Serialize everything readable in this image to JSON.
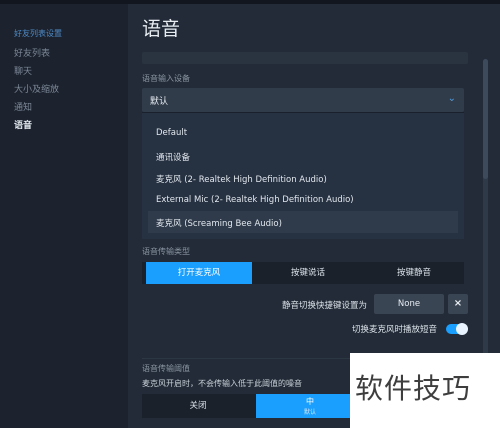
{
  "sidebar": {
    "header": "好友列表设置",
    "items": [
      {
        "label": "好友列表",
        "active": false
      },
      {
        "label": "聊天",
        "active": false
      },
      {
        "label": "大小及缩放",
        "active": false
      },
      {
        "label": "通知",
        "active": false
      },
      {
        "label": "语音",
        "active": true
      }
    ]
  },
  "main": {
    "title": "语音",
    "input_device": {
      "label": "语音输入设备",
      "selected": "默认",
      "options": [
        "Default",
        "通讯设备",
        "麦克风 (2- Realtek High Definition Audio)",
        "External Mic (2- Realtek High Definition Audio)",
        "麦克风 (Screaming Bee Audio)"
      ],
      "highlighted_index": 4
    },
    "transmission_type": {
      "label": "语音传输类型",
      "options": [
        "打开麦克风",
        "按键说话",
        "按键静音"
      ],
      "active_index": 0
    },
    "mute_hotkey": {
      "label": "静音切换快捷键设置为",
      "value": "None",
      "clear_glyph": "×"
    },
    "mic_toggle_sound": {
      "label": "切换麦克风时播放短音",
      "enabled": true
    },
    "threshold": {
      "label": "语音传输阈值",
      "description": "麦克风开启时，不会传输入低于此阈值的噪音",
      "options": [
        {
          "label": "关闭",
          "sub": ""
        },
        {
          "label": "中",
          "sub": "默认"
        }
      ],
      "active_index": 1
    }
  },
  "watermark": "软件技巧",
  "colors": {
    "accent": "#1a9fff",
    "sidebar_header": "#4f8ac4",
    "background": "#222b37",
    "sidebar_bg": "#1c232f"
  }
}
